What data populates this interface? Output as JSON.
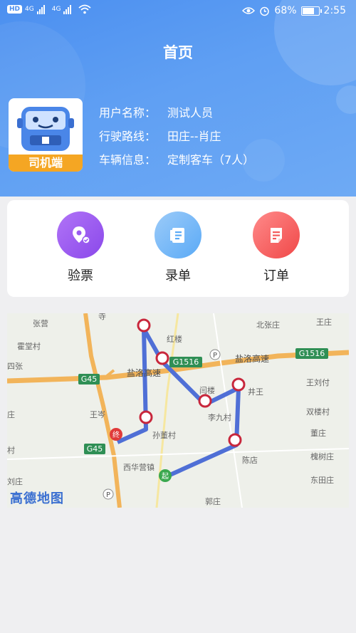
{
  "status_bar": {
    "hd": "HD",
    "net1": "4G",
    "net2": "4G",
    "battery": "68%",
    "time": "2:55",
    "battery_level": 0.68
  },
  "header": {
    "title": "首页",
    "avatar_label": "司机端",
    "rows": [
      {
        "key": "用户名称：",
        "value": "测试人员"
      },
      {
        "key": "行驶路线：",
        "value": "田庄--肖庄"
      },
      {
        "key": "车辆信息：",
        "value": "定制客车（7人）"
      }
    ]
  },
  "actions": [
    {
      "label": "验票",
      "icon": "ticket-check-icon",
      "color": "#9a5cf0"
    },
    {
      "label": "录单",
      "icon": "document-list-icon",
      "color": "#5aaaf6"
    },
    {
      "label": "订单",
      "icon": "order-icon",
      "color": "#f35b5b"
    }
  ],
  "map": {
    "brand": "高德地图",
    "places": [
      "张营",
      "霍堂村",
      "四张",
      "王岑",
      "庄",
      "村",
      "刘庄",
      "红楼",
      "北张庄",
      "王庄",
      "孙董村",
      "西华营镇",
      "李九村",
      "井王",
      "王刘付",
      "双楼村",
      "董庄",
      "槐树庄",
      "东田庄",
      "郭庄",
      "陈店",
      "闫楼",
      "寺"
    ],
    "road_labels": [
      "G45",
      "G45",
      "G1516",
      "G1516",
      "盐洛高速",
      "盐洛高速"
    ],
    "start_marker": "起",
    "end_marker": "终"
  }
}
